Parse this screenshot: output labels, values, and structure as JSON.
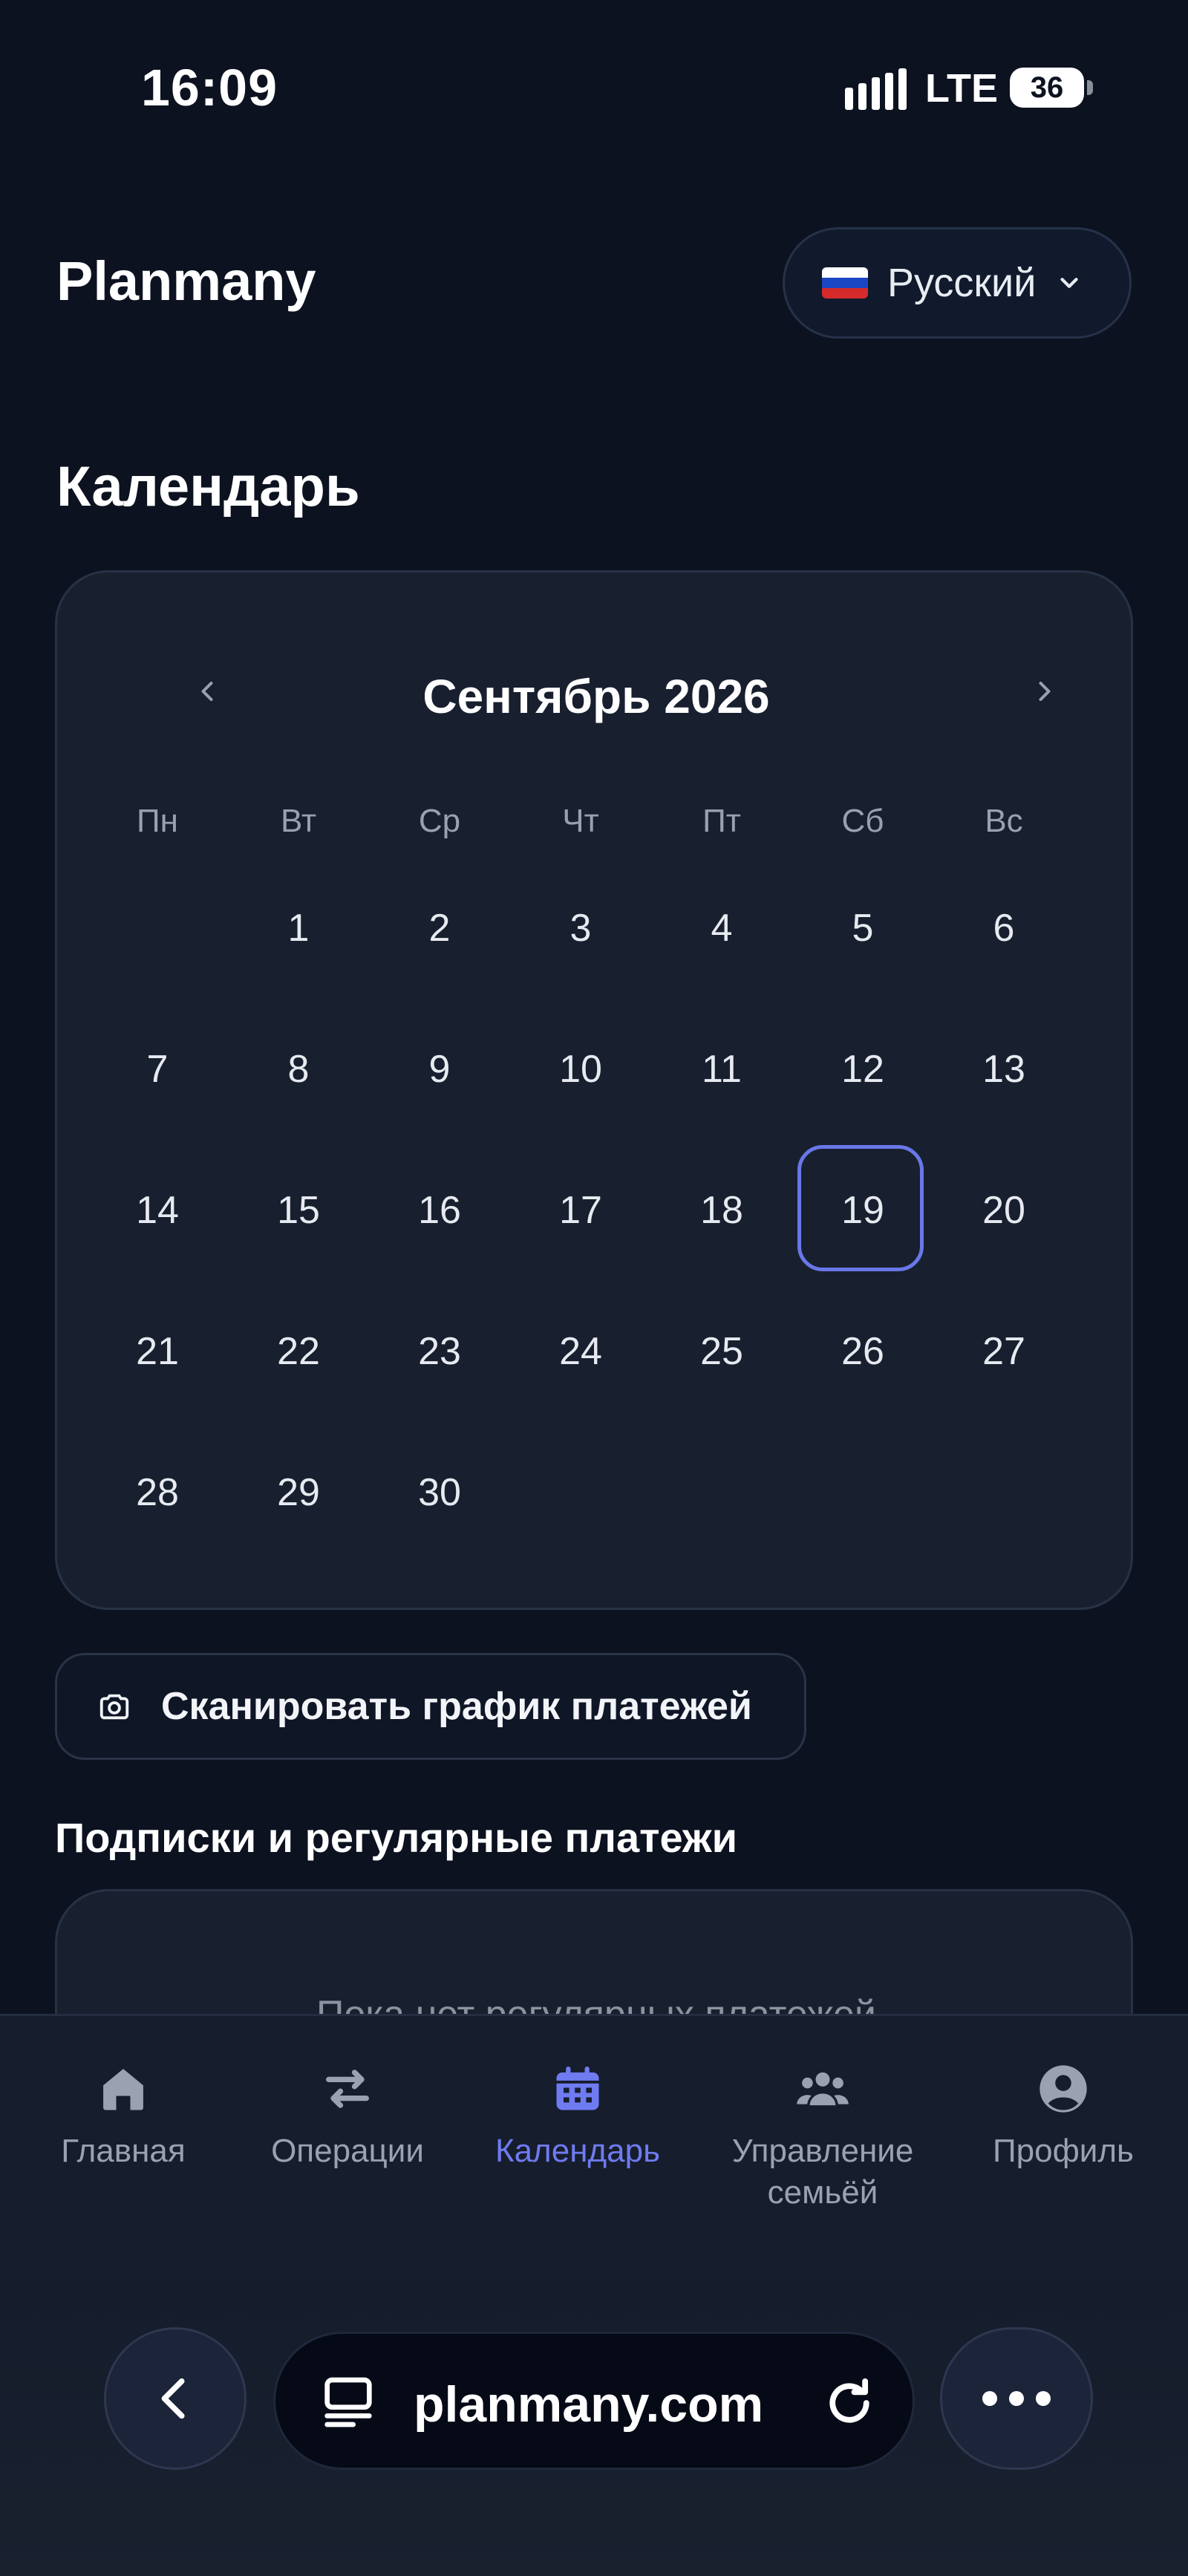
{
  "status_bar": {
    "time": "16:09",
    "network": "LTE",
    "battery": "36"
  },
  "header": {
    "app_title": "Planmany",
    "language": "Русский",
    "language_flag": "russia-flag-icon"
  },
  "page": {
    "title": "Календарь"
  },
  "calendar": {
    "month_label": "Сентябрь 2026",
    "weekdays": [
      "Пн",
      "Вт",
      "Ср",
      "Чт",
      "Пт",
      "Сб",
      "Вс"
    ],
    "first_day_column": 2,
    "days": [
      "1",
      "2",
      "3",
      "4",
      "5",
      "6",
      "7",
      "8",
      "9",
      "10",
      "11",
      "12",
      "13",
      "14",
      "15",
      "16",
      "17",
      "18",
      "19",
      "20",
      "21",
      "22",
      "23",
      "24",
      "25",
      "26",
      "27",
      "28",
      "29",
      "30"
    ],
    "selected_day": "19",
    "accent_color": "#6a77e8"
  },
  "scan_button": {
    "label": "Сканировать график платежей",
    "icon": "camera-icon"
  },
  "subscriptions": {
    "title": "Подписки и регулярные платежи",
    "empty_text": "Пока нет регулярных платежей"
  },
  "bottom_nav": {
    "items": [
      {
        "label": "Главная",
        "icon": "home-icon",
        "active": false
      },
      {
        "label": "Операции",
        "icon": "transfer-icon",
        "active": false
      },
      {
        "label": "Календарь",
        "icon": "calendar-icon",
        "active": true
      },
      {
        "label": "Управление семьёй",
        "icon": "family-icon",
        "active": false
      },
      {
        "label": "Профиль",
        "icon": "profile-icon",
        "active": false
      }
    ],
    "active_color": "#6f7bf0"
  },
  "browser": {
    "url": "planmany.com"
  }
}
